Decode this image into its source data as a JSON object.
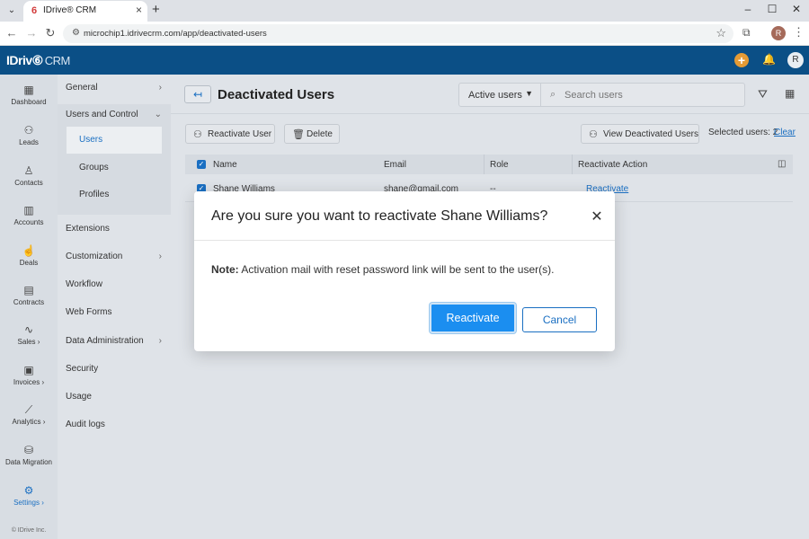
{
  "browser": {
    "tab_title": "IDrive® CRM",
    "url": "microchip1.idrivecrm.com/app/deactivated-users",
    "profile_initial": "R"
  },
  "app": {
    "logo_brand": "IDriv",
    "logo_suffix": "CRM",
    "user_initial": "R",
    "accent_color": "#1a6fc2",
    "header_color": "#0b4f86"
  },
  "iconnav": {
    "items": [
      {
        "label": "Dashboard",
        "icon": "dashboard-icon"
      },
      {
        "label": "Leads",
        "icon": "leads-icon"
      },
      {
        "label": "Contacts",
        "icon": "contacts-icon"
      },
      {
        "label": "Accounts",
        "icon": "accounts-icon"
      },
      {
        "label": "Deals",
        "icon": "deals-icon"
      },
      {
        "label": "Contracts",
        "icon": "contracts-icon"
      },
      {
        "label": "Sales ›",
        "icon": "sales-icon"
      },
      {
        "label": "Invoices ›",
        "icon": "invoices-icon"
      },
      {
        "label": "Analytics ›",
        "icon": "analytics-icon"
      },
      {
        "label": "Data Migration",
        "icon": "data-migration-icon"
      },
      {
        "label": "Settings ›",
        "icon": "settings-icon"
      }
    ],
    "copyright": "© IDrive Inc."
  },
  "settings_menu": {
    "general": "General",
    "users_and_control": "Users and Control",
    "users": "Users",
    "groups": "Groups",
    "profiles": "Profiles",
    "extensions": "Extensions",
    "customization": "Customization",
    "workflow": "Workflow",
    "web_forms": "Web Forms",
    "data_administration": "Data Administration",
    "security": "Security",
    "usage": "Usage",
    "audit_logs": "Audit logs"
  },
  "page": {
    "title": "Deactivated Users",
    "filter_value": "Active users",
    "search_placeholder": "Search users",
    "reactivate_user_label": "Reactivate User",
    "delete_label": "Delete",
    "view_deactivated_label": "View Deactivated Users",
    "selected_users": "Selected users: 2",
    "clear_label": "Clear"
  },
  "table": {
    "headers": {
      "name": "Name",
      "email": "Email",
      "role": "Role",
      "action": "Reactivate Action"
    },
    "rows": [
      {
        "name": "Shane Williams",
        "email": "shane@gmail.com",
        "role": "--",
        "action": "Reactivate"
      }
    ]
  },
  "modal": {
    "title": "Are you sure you want to reactivate Shane Williams?",
    "note_label": "Note:",
    "note_text": " Activation mail with reset password link will be sent to the user(s).",
    "confirm_label": "Reactivate",
    "cancel_label": "Cancel"
  }
}
